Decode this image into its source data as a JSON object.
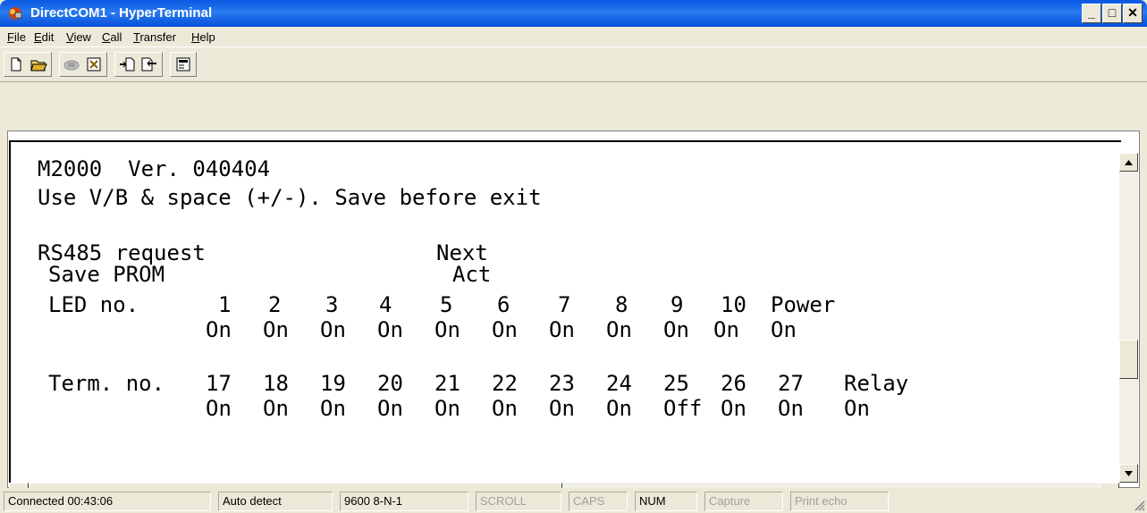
{
  "window": {
    "title": "DirectCOM1 - HyperTerminal",
    "minimize_label": "_",
    "maximize_label": "□",
    "close_label": "✕"
  },
  "menu": [
    "File",
    "Edit",
    "View",
    "Call",
    "Transfer",
    "Help"
  ],
  "toolbar": {
    "buttons": [
      "new-icon",
      "open-icon",
      "phone-icon",
      "disconnect-icon",
      "send-icon",
      "receive-icon",
      "properties-icon"
    ]
  },
  "terminal": {
    "line1": "M2000  Ver. 040404",
    "line2": "Use V/B & space (+/-). Save before exit",
    "rs485": "RS485 request",
    "next": "Next",
    "save_prom": "Save PROM",
    "act": "Act",
    "led_label": "LED no.",
    "led_numbers": [
      "1",
      "2",
      "3",
      "4",
      "5",
      "6",
      "7",
      "8",
      "9",
      "10",
      "Power"
    ],
    "led_states": [
      "On",
      "On",
      "On",
      "On",
      "On",
      "On",
      "On",
      "On",
      "On",
      "On",
      "On"
    ],
    "term_label": "Term. no.",
    "term_numbers": [
      "17",
      "18",
      "19",
      "20",
      "21",
      "22",
      "23",
      "24",
      "25",
      "26",
      "27",
      "Relay"
    ],
    "term_states": [
      "On",
      "On",
      "On",
      "On",
      "On",
      "On",
      "On",
      "On",
      "Off",
      "On",
      "On",
      "On"
    ]
  },
  "statusbar": {
    "connected": "Connected 00:43:06",
    "detect": "Auto detect",
    "settings": "9600 8-N-1",
    "scroll": "SCROLL",
    "caps": "CAPS",
    "num": "NUM",
    "capture": "Capture",
    "print_echo": "Print echo"
  }
}
